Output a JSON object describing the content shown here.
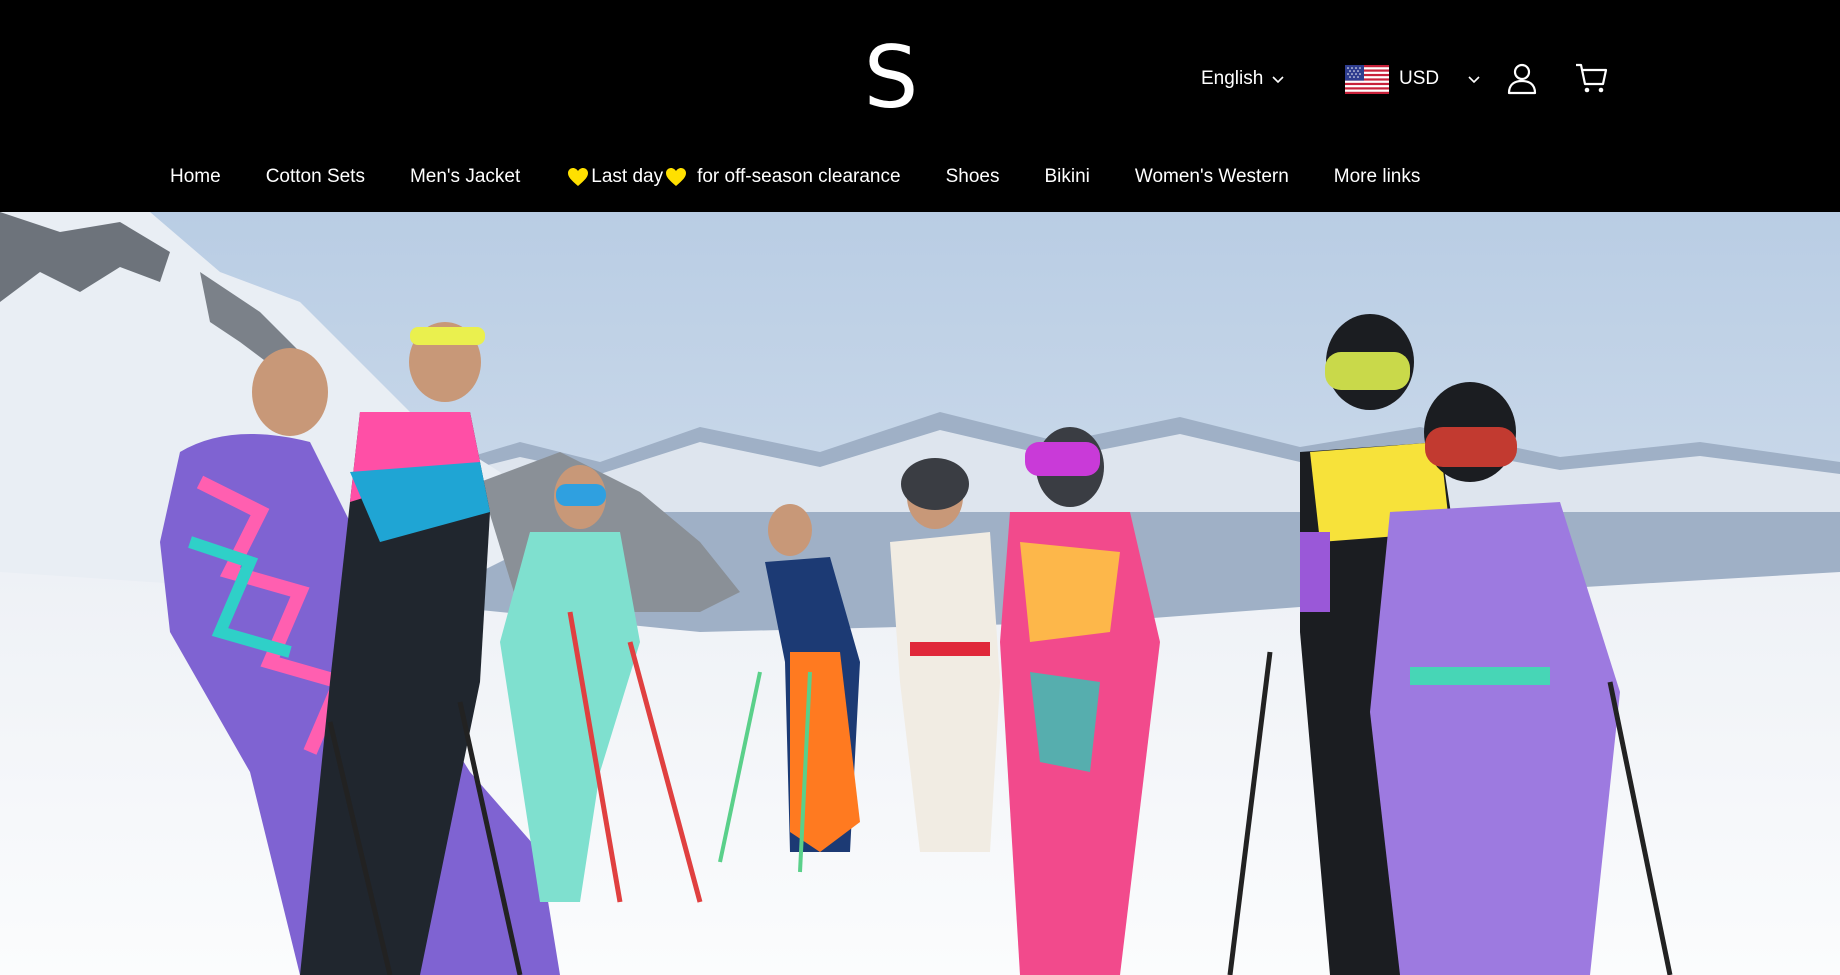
{
  "header": {
    "logo_letter": "S",
    "language": "English",
    "currency": "USD",
    "flag": "us-flag-icon",
    "account_icon": "user-icon",
    "cart_icon": "cart-icon"
  },
  "nav": {
    "items": [
      {
        "label": "Home"
      },
      {
        "label": "Cotton Sets"
      },
      {
        "label": "Men's Jacket"
      },
      {
        "label_part1": "Last day",
        "label_part2": "for off-season clearance",
        "icon": "yellow-heart-icon"
      },
      {
        "label": "Shoes"
      },
      {
        "label": "Bikini"
      },
      {
        "label": "Women's Western"
      },
      {
        "label": "More links"
      }
    ]
  },
  "colors": {
    "header_bg": "#000000",
    "text": "#ffffff",
    "heart": "#ffe000",
    "sky": "#c9d8ea",
    "snow": "#f3f5f8"
  },
  "hero": {
    "image": "group-of-skiers-in-colorful-retro-ski-suits-on-snowy-mountain"
  }
}
